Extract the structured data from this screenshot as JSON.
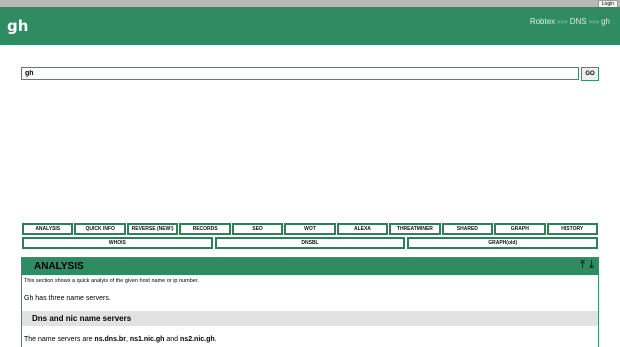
{
  "login_label": "Login",
  "logo": "gh",
  "breadcrumb": [
    "Robtex",
    "DNS",
    "gh"
  ],
  "breadcrumb_sep": ">>>",
  "search": {
    "value": "gh",
    "button": "GO"
  },
  "tabs_row1": [
    "ANALYSIS",
    "QUICK INFO",
    "REVERSE (NEW!)",
    "RECORDS",
    "SEO",
    "WOT",
    "ALEXA",
    "THREATMINER",
    "SHARED",
    "GRAPH",
    "HISTORY"
  ],
  "tabs_row2": [
    "WHOIS",
    "DNSBL",
    "GRAPH(old)"
  ],
  "panel": {
    "title": "ANALYSIS",
    "icon_up": "⤒",
    "icon_down": "⤓",
    "description": "This section shows a quick analyis of the given host name or ip number.",
    "summary": "Gh has three name servers.",
    "subtitle": "Dns and nic name servers",
    "ns_text": {
      "prefix": "The name servers are ",
      "ns1": "ns.dns.br",
      "sep1": ", ",
      "ns2": "ns1.nic.gh",
      "sep2": " and ",
      "ns3": "ns2.nic.gh",
      "suffix": "."
    }
  },
  "colors": {
    "brand_green": "#2e8b62",
    "border_green": "#2f7f5a"
  }
}
